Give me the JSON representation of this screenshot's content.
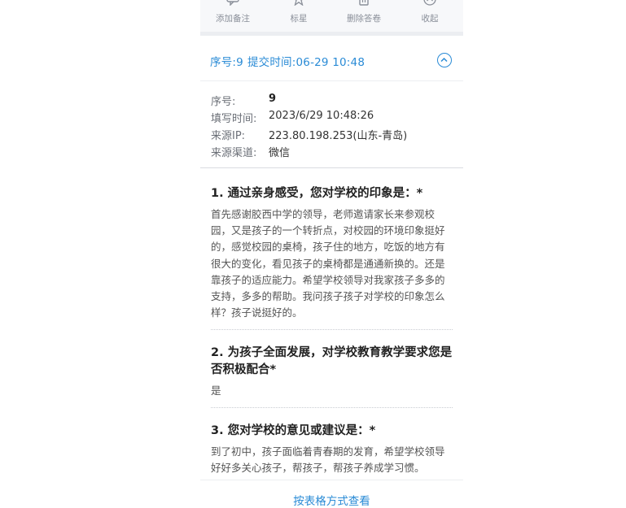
{
  "toolbar": {
    "items": [
      {
        "label": "添加备注",
        "icon": "comment-icon"
      },
      {
        "label": "标星",
        "icon": "star-icon"
      },
      {
        "label": "删除答卷",
        "icon": "trash-icon"
      },
      {
        "label": "收起",
        "icon": "collapse-icon"
      }
    ]
  },
  "header": {
    "serial_label": "序号:9",
    "submit_label": "提交时间:06-29 10:48"
  },
  "meta": {
    "serial": {
      "key": "序号:",
      "value": "9"
    },
    "fill_time": {
      "key": "填写时间:",
      "value": "2023/6/29 10:48:26"
    },
    "source_ip": {
      "key": "来源IP:",
      "value": "223.80.198.253(山东-青岛)"
    },
    "channel": {
      "key": "来源渠道:",
      "value": "微信"
    }
  },
  "questions": [
    {
      "title": "1. 通过亲身感受，您对学校的印象是：*",
      "answer": "首先感谢胶西中学的领导，老师邀请家长来参观校园，又是孩子的一个转折点，对校园的环境印象挺好的，感觉校园的桌椅，孩子住的地方，吃饭的地方有很大的变化，看见孩子的桌椅都是通通新换的。还是靠孩子的适应能力。希望学校领导对我家孩子多多的支持，多多的帮助。我问孩子孩子对学校的印象怎么样？孩子说挺好的。"
    },
    {
      "title": "2. 为孩子全面发展，对学校教育教学要求您是否积极配合*",
      "answer": "是"
    },
    {
      "title": "3. 您对学校的意见或建议是：*",
      "answer": "到了初中，孩子面临着青春期的发育，希望学校领导好好多关心孩子，帮孩子，帮孩子养成学习惯。"
    }
  ],
  "footer": {
    "table_view_link": "按表格方式查看"
  },
  "colors": {
    "accent": "#2a8bd6",
    "muted": "#8a8f99"
  }
}
